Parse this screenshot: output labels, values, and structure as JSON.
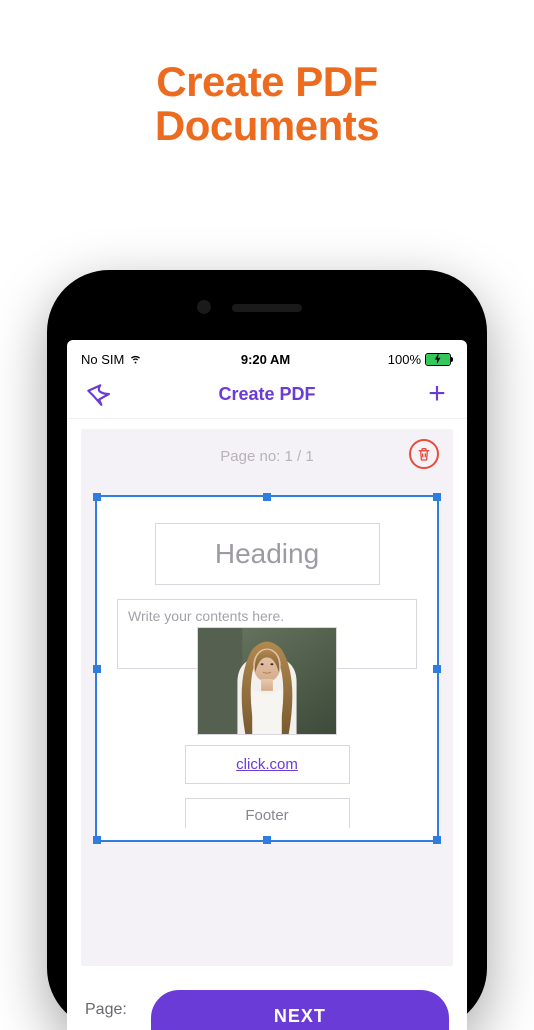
{
  "promo": {
    "line1": "Create PDF",
    "line2": "Documents"
  },
  "statusbar": {
    "carrier": "No SIM",
    "time": "9:20 AM",
    "battery_pct": "100%"
  },
  "nav": {
    "title": "Create PDF"
  },
  "canvas": {
    "page_no_label": "Page no: 1 / 1"
  },
  "editor": {
    "heading_placeholder": "Heading",
    "content_placeholder": "Write your contents here.",
    "link_text": "click.com",
    "footer_placeholder": "Footer"
  },
  "bottom": {
    "page_label": "Page:",
    "next_label": "NEXT"
  }
}
